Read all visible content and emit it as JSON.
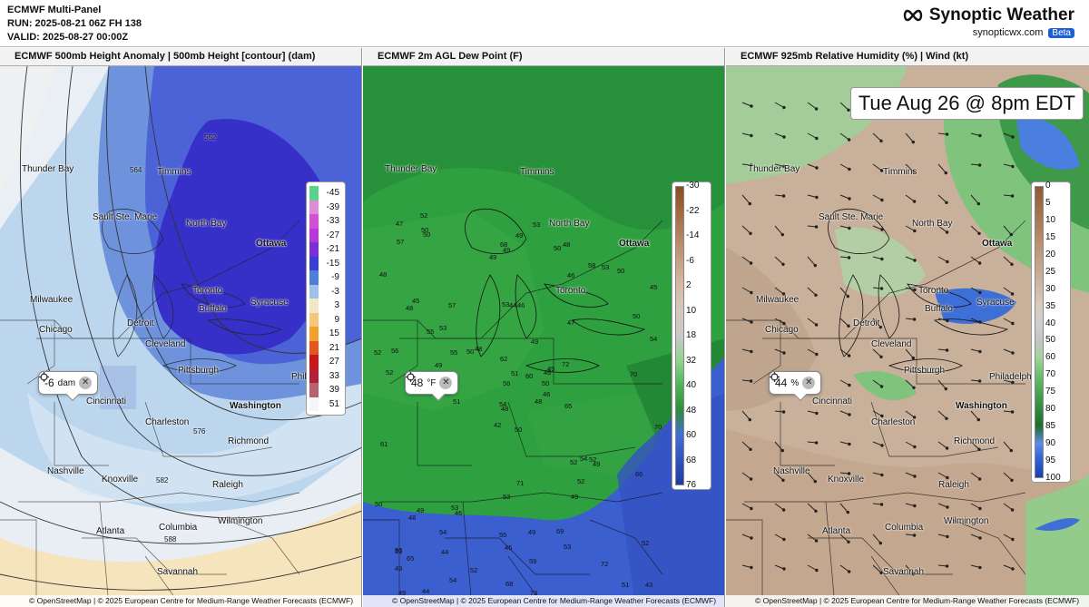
{
  "header": {
    "title": "ECMWF Multi-Panel",
    "run": "RUN: 2025-08-21 06Z FH 138",
    "valid": "VALID: 2025-08-27 00:00Z",
    "brand_icon": "infinity-icon",
    "brand_name": "Synoptic Weather",
    "brand_site": "synopticwx.com",
    "beta": "Beta"
  },
  "panels": [
    {
      "title": "ECMWF 500mb Height Anomaly | 500mb Height [contour] (dam)",
      "probe": {
        "value": "-6",
        "unit": "dam"
      },
      "legend": {
        "labels": [
          "-45",
          "-39",
          "-33",
          "-27",
          "-21",
          "-15",
          "-9",
          "-3",
          "3",
          "9",
          "15",
          "21",
          "27",
          "33",
          "39",
          "51"
        ],
        "colors": [
          "#57d38a",
          "#e08bd8",
          "#d44fd4",
          "#b934d9",
          "#7a2fd9",
          "#3a3fd6",
          "#4d7fd6",
          "#9dc1e8",
          "#f4e7c6",
          "#f6c67a",
          "#f3a12d",
          "#e4561e",
          "#c8161c",
          "#b21f37",
          "#b5616e",
          "#f6f6f6"
        ]
      },
      "contour_labels": [
        "552",
        "564",
        "576",
        "582",
        "588"
      ]
    },
    {
      "title": "ECMWF 2m AGL Dew Point (F)",
      "probe": {
        "value": "48",
        "unit": "°F"
      },
      "legend": {
        "labels": [
          "-30",
          "-22",
          "-14",
          "-6",
          "2",
          "10",
          "18",
          "32",
          "40",
          "48",
          "60",
          "68",
          "76"
        ],
        "colors": [
          "#8a4b1e",
          "#a5673a",
          "#b88260",
          "#c99f83",
          "#d8b9a4",
          "#d6c7bf",
          "#c8c8c8",
          "#8fd68d",
          "#4cb652",
          "#2d8f3a",
          "#3f6fd6",
          "#2d54c4",
          "#1f3aa0"
        ]
      },
      "dewpoints": [
        "50",
        "48",
        "48",
        "50",
        "46",
        "46",
        "48",
        "46",
        "46",
        "48",
        "50",
        "43",
        "47",
        "45",
        "42",
        "47",
        "44",
        "53",
        "49",
        "49",
        "48",
        "49",
        "44",
        "44",
        "49",
        "49",
        "45",
        "49",
        "52",
        "52",
        "54",
        "54",
        "55",
        "56",
        "57",
        "58",
        "53",
        "51",
        "52",
        "52",
        "53",
        "50",
        "49",
        "49",
        "54",
        "52",
        "50",
        "49",
        "46",
        "46",
        "48",
        "50",
        "48",
        "52",
        "53",
        "54",
        "50",
        "47",
        "49",
        "50",
        "49",
        "51",
        "56",
        "53",
        "53",
        "52",
        "50",
        "49",
        "51",
        "50",
        "53",
        "52",
        "54",
        "55",
        "51",
        "57",
        "55",
        "61",
        "62",
        "59",
        "60",
        "65",
        "65",
        "66",
        "68",
        "70",
        "71",
        "72",
        "73",
        "69",
        "68",
        "70",
        "72"
      ]
    },
    {
      "title": "ECMWF 925mb Relative Humidity (%) | Wind (kt)",
      "probe": {
        "value": "44",
        "unit": "%"
      },
      "date_label": "Tue Aug 26 @ 8pm EDT",
      "legend": {
        "labels": [
          "0",
          "5",
          "10",
          "15",
          "20",
          "25",
          "30",
          "35",
          "40",
          "50",
          "60",
          "70",
          "75",
          "80",
          "85",
          "90",
          "95",
          "100"
        ],
        "colors": [
          "#8e5a34",
          "#9c6a44",
          "#a97a56",
          "#b58b6a",
          "#c09c7f",
          "#c9ab93",
          "#d2bba8",
          "#d9ccc0",
          "#cfcfcf",
          "#c4c4c4",
          "#9fd59a",
          "#6cc06e",
          "#49a651",
          "#2f8a3c",
          "#1f6b2d",
          "#5b8ce8",
          "#2c5fd8",
          "#1b3fb0"
        ]
      }
    }
  ],
  "cities": [
    {
      "name": "Thunder Bay",
      "bold": false
    },
    {
      "name": "Timmins",
      "bold": false
    },
    {
      "name": "Sault Ste. Marie",
      "bold": false
    },
    {
      "name": "North Bay",
      "bold": false
    },
    {
      "name": "Ottawa",
      "bold": true
    },
    {
      "name": "Milwaukee",
      "bold": false
    },
    {
      "name": "Toronto",
      "bold": false
    },
    {
      "name": "Syracuse",
      "bold": false
    },
    {
      "name": "Chicago",
      "bold": false
    },
    {
      "name": "Detroit",
      "bold": false
    },
    {
      "name": "Buffalo",
      "bold": false
    },
    {
      "name": "Cleveland",
      "bold": false
    },
    {
      "name": "Pittsburgh",
      "bold": false
    },
    {
      "name": "Philadelphi",
      "bold": false
    },
    {
      "name": "Cincinnati",
      "bold": false
    },
    {
      "name": "Washington",
      "bold": true
    },
    {
      "name": "Charleston",
      "bold": false
    },
    {
      "name": "Richmond",
      "bold": false
    },
    {
      "name": "Nashville",
      "bold": false
    },
    {
      "name": "Knoxville",
      "bold": false
    },
    {
      "name": "Raleigh",
      "bold": false
    },
    {
      "name": "Wilmington",
      "bold": false
    },
    {
      "name": "Atlanta",
      "bold": false
    },
    {
      "name": "Columbia",
      "bold": false
    },
    {
      "name": "Savannah",
      "bold": false
    }
  ],
  "attribution": "© OpenStreetMap | © 2025 European Centre for Medium-Range Weather Forecasts (ECMWF)"
}
